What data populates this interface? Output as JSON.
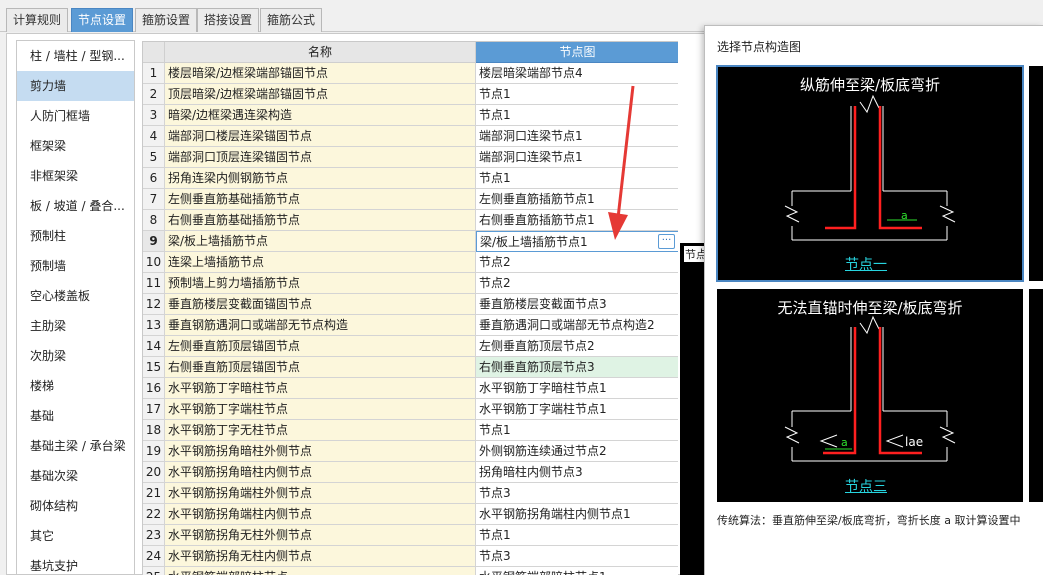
{
  "tabs": [
    "计算规则",
    "节点设置",
    "箍筋设置",
    "搭接设置",
    "箍筋公式"
  ],
  "categories": [
    "柱 / 墙柱 / 型钢...",
    "剪力墙",
    "人防门框墙",
    "框架梁",
    "非框架梁",
    "板 / 坡道 / 叠合...",
    "预制柱",
    "预制墙",
    "空心楼盖板",
    "主肋梁",
    "次肋梁",
    "楼梯",
    "基础",
    "基础主梁 / 承台梁",
    "基础次梁",
    "砌体结构",
    "其它",
    "基坑支护"
  ],
  "table": {
    "headers": {
      "name": "名称",
      "node": "节点图"
    },
    "rows": [
      {
        "num": "1",
        "name": "楼层暗梁/边框梁端部锚固节点",
        "node": "楼层暗梁端部节点4"
      },
      {
        "num": "2",
        "name": "顶层暗梁/边框梁端部锚固节点",
        "node": "节点1"
      },
      {
        "num": "3",
        "name": "暗梁/边框梁遇连梁构造",
        "node": "节点1"
      },
      {
        "num": "4",
        "name": "端部洞口楼层连梁锚固节点",
        "node": "端部洞口连梁节点1"
      },
      {
        "num": "5",
        "name": "端部洞口顶层连梁锚固节点",
        "node": "端部洞口连梁节点1"
      },
      {
        "num": "6",
        "name": "拐角连梁内侧钢筋节点",
        "node": "节点1"
      },
      {
        "num": "7",
        "name": "左侧垂直筋基础插筋节点",
        "node": "左侧垂直筋插筋节点1"
      },
      {
        "num": "8",
        "name": "右侧垂直筋基础插筋节点",
        "node": "右侧垂直筋插筋节点1"
      },
      {
        "num": "9",
        "name": "梁/板上墙插筋节点",
        "node": "梁/板上墙插筋节点1"
      },
      {
        "num": "10",
        "name": "连梁上墙插筋节点",
        "node": "节点2"
      },
      {
        "num": "11",
        "name": "预制墙上剪力墙插筋节点",
        "node": "节点2"
      },
      {
        "num": "12",
        "name": "垂直筋楼层变截面锚固节点",
        "node": "垂直筋楼层变截面节点3"
      },
      {
        "num": "13",
        "name": "垂直钢筋遇洞口或端部无节点构造",
        "node": "垂直筋遇洞口或端部无节点构造2"
      },
      {
        "num": "14",
        "name": "左侧垂直筋顶层锚固节点",
        "node": "左侧垂直筋顶层节点2"
      },
      {
        "num": "15",
        "name": "右侧垂直筋顶层锚固节点",
        "node": "右侧垂直筋顶层节点3"
      },
      {
        "num": "16",
        "name": "水平钢筋丁字暗柱节点",
        "node": "水平钢筋丁字暗柱节点1"
      },
      {
        "num": "17",
        "name": "水平钢筋丁字端柱节点",
        "node": "水平钢筋丁字端柱节点1"
      },
      {
        "num": "18",
        "name": "水平钢筋丁字无柱节点",
        "node": "节点1"
      },
      {
        "num": "19",
        "name": "水平钢筋拐角暗柱外侧节点",
        "node": "外侧钢筋连续通过节点2"
      },
      {
        "num": "20",
        "name": "水平钢筋拐角暗柱内侧节点",
        "node": "拐角暗柱内侧节点3"
      },
      {
        "num": "21",
        "name": "水平钢筋拐角端柱外侧节点",
        "node": "节点3"
      },
      {
        "num": "22",
        "name": "水平钢筋拐角端柱内侧节点",
        "node": "水平钢筋拐角端柱内侧节点1"
      },
      {
        "num": "23",
        "name": "水平钢筋拐角无柱外侧节点",
        "node": "节点1"
      },
      {
        "num": "24",
        "name": "水平钢筋拐角无柱内侧节点",
        "node": "节点3"
      },
      {
        "num": "25",
        "name": "水平钢筋端部暗柱节点",
        "node": "水平钢筋端部暗柱节点1"
      }
    ],
    "current_row": "9",
    "highlight_row": "15",
    "ellipsis": "···"
  },
  "side_label": "节点",
  "popup": {
    "title": "选择节点构造图",
    "cards": [
      {
        "title": "纵筋伸至梁/板底弯折",
        "label": "节点一",
        "annot1": "a"
      },
      {
        "title": "无法直锚时伸至梁/板底弯折",
        "label": "节点三",
        "annot1": "a",
        "annot2": "lae"
      }
    ],
    "footnote": "传统算法：垂直筋伸至梁/板底弯折，弯折长度 a 取计算设置中"
  },
  "colors": {
    "accent": "#5b9bd5",
    "rebar": "#ff2020",
    "label": "#27d4df",
    "arrow": "#e53935"
  }
}
